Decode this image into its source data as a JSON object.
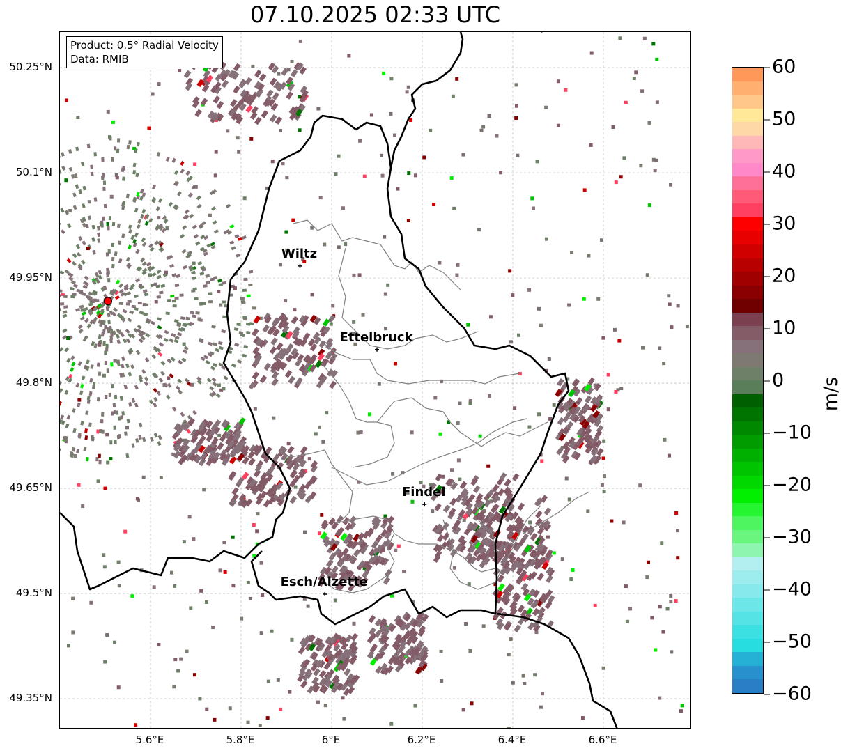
{
  "title": "07.10.2025 02:33 UTC",
  "info_box": {
    "product": "Product: 0.5° Radial Velocity",
    "data": "Data: RMIB"
  },
  "axes": {
    "lon_range": [
      5.4,
      6.795
    ],
    "lat_range": [
      49.29,
      50.33
    ],
    "x_ticks": [
      {
        "value": 5.6,
        "label": "5.6°E"
      },
      {
        "value": 5.8,
        "label": "5.8°E"
      },
      {
        "value": 6.0,
        "label": "6°E"
      },
      {
        "value": 6.2,
        "label": "6.2°E"
      },
      {
        "value": 6.4,
        "label": "6.4°E"
      },
      {
        "value": 6.6,
        "label": "6.6°E"
      }
    ],
    "y_ticks": [
      {
        "value": 50.25,
        "label": "50.25°N"
      },
      {
        "value": 50.1,
        "label": "50.1°N"
      },
      {
        "value": 49.95,
        "label": "49.95°N"
      },
      {
        "value": 49.8,
        "label": "49.8°N"
      },
      {
        "value": 49.65,
        "label": "49.65°N"
      },
      {
        "value": 49.5,
        "label": "49.5°N"
      },
      {
        "value": 49.35,
        "label": "49.35°N"
      }
    ]
  },
  "cities": [
    {
      "name": "Wiltz",
      "lon": 5.93,
      "lat": 49.967
    },
    {
      "name": "Ettelbruck",
      "lon": 6.1,
      "lat": 49.848
    },
    {
      "name": "Findel",
      "lon": 6.205,
      "lat": 49.627
    },
    {
      "name": "Esch/Alzette",
      "lon": 5.985,
      "lat": 49.499
    }
  ],
  "radar_site": {
    "lon": 5.506,
    "lat": 49.917,
    "color": "#ff0000"
  },
  "colorbar": {
    "label": "m/s",
    "range": [
      -60,
      60
    ],
    "ticks": [
      {
        "value": 60,
        "label": "60"
      },
      {
        "value": 50,
        "label": "50"
      },
      {
        "value": 40,
        "label": "40"
      },
      {
        "value": 30,
        "label": "30"
      },
      {
        "value": 20,
        "label": "20"
      },
      {
        "value": 10,
        "label": "10"
      },
      {
        "value": 0,
        "label": "0"
      },
      {
        "value": -10,
        "label": "−10"
      },
      {
        "value": -20,
        "label": "−20"
      },
      {
        "value": -30,
        "label": "−30"
      },
      {
        "value": -40,
        "label": "−40"
      },
      {
        "value": -50,
        "label": "−50"
      },
      {
        "value": -60,
        "label": "−60"
      }
    ],
    "colors": [
      "#2a7fc4",
      "#2890cc",
      "#25b0d5",
      "#28dde0",
      "#3ce0e3",
      "#55e3e6",
      "#6de6e8",
      "#86e9eb",
      "#9decee",
      "#b3eff0",
      "#8ef5b0",
      "#6af57f",
      "#4ef560",
      "#25f530",
      "#00f000",
      "#00d800",
      "#00c400",
      "#00b000",
      "#009c00",
      "#008800",
      "#007400",
      "#006000",
      "#5a7e5a",
      "#6e8068",
      "#7e7a72",
      "#86707a",
      "#845c68",
      "#7a4050",
      "#700000",
      "#8a0000",
      "#a00000",
      "#b80000",
      "#d00000",
      "#e80000",
      "#ff0000",
      "#ff4060",
      "#ff5a78",
      "#ff7098",
      "#ff88c8",
      "#ff9ac8",
      "#ffb8b8",
      "#ffd8a8",
      "#ffe898",
      "#ffc888",
      "#ffb070",
      "#ff9858"
    ]
  }
}
